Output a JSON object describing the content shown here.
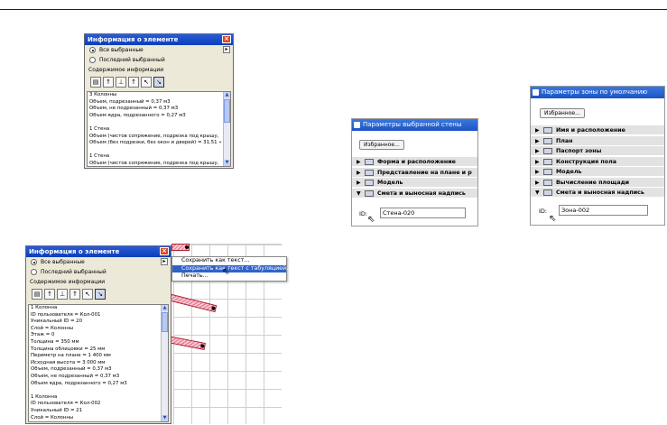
{
  "info_window_top": {
    "title": "Информация о элементе",
    "close": "×",
    "radio_all": "Все выбранные",
    "radio_last": "Последний выбранный",
    "content_label": "Содержимое информации",
    "lines": [
      "3 Колонны",
      "Объем, подрезанный = 0,37 м3",
      "Объем, не подрезанный = 0,37 м3",
      "Объем ядра, подрезанного = 0,27 м3",
      "",
      "1 Стена",
      "Объем (чистов сопряжение, подрезка под крышу,",
      "Объем (без подрезки, без окон и дверей) = 31,51 »",
      "",
      "1 Стена",
      "Объем (чистов сопряжение, подрезка под крышу,"
    ]
  },
  "wall_params": {
    "title": "Параметры выбранной стены",
    "favorites": "Избранное...",
    "rows": [
      {
        "tri": "▶",
        "label": "Форма и расположение"
      },
      {
        "tri": "▶",
        "label": "Представление на плане и р"
      },
      {
        "tri": "▶",
        "label": "Модель"
      },
      {
        "tri": "▼",
        "label": "Смета и выносная надпись"
      }
    ],
    "id_label": "ID:",
    "id_value": "Стена-020"
  },
  "zone_params": {
    "title": "Параметры зоны по умолчанию",
    "favorites": "Избранное...",
    "rows": [
      {
        "tri": "▶",
        "label": "Имя и расположение"
      },
      {
        "tri": "▶",
        "label": "План"
      },
      {
        "tri": "▶",
        "label": "Паспорт зоны"
      },
      {
        "tri": "▶",
        "label": "Конструкция пола"
      },
      {
        "tri": "▶",
        "label": "Модель"
      },
      {
        "tri": "▶",
        "label": "Вычисление площади"
      },
      {
        "tri": "▼",
        "label": "Смета и выносная надпись"
      }
    ],
    "id_label": "ID:",
    "id_value": "Зона-002"
  },
  "info_window_bottom": {
    "title": "Информация о элементе",
    "close": "×",
    "radio_all": "Все выбранные",
    "radio_last": "Последний выбранный",
    "content_label": "Содержимое информации",
    "lines": [
      "1 Колонна",
      "ID пользователя = Кол-001",
      "Уникальный ID = 20",
      "Слой = Колонны",
      "Этаж = 0",
      "Толщина = 350 мм",
      "Толщина облицовки = 25 мм",
      "Периметр на плане = 1 400 мм",
      "Исходная высота = 3 000 мм",
      "Объем, подрезанный = 0,37 м3",
      "Объем, не подрезанный = 0,37 м3",
      "Объем ядра, подрезанного = 0,27 м3",
      "",
      "1 Колонна",
      "ID пользователя = Кол-002",
      "Уникальный ID = 21",
      "Слой = Колонны"
    ]
  },
  "context_menu": {
    "items": [
      "Сохранить как текст...",
      "Сохранить как текст с табуляцией...",
      "Печать..."
    ]
  }
}
